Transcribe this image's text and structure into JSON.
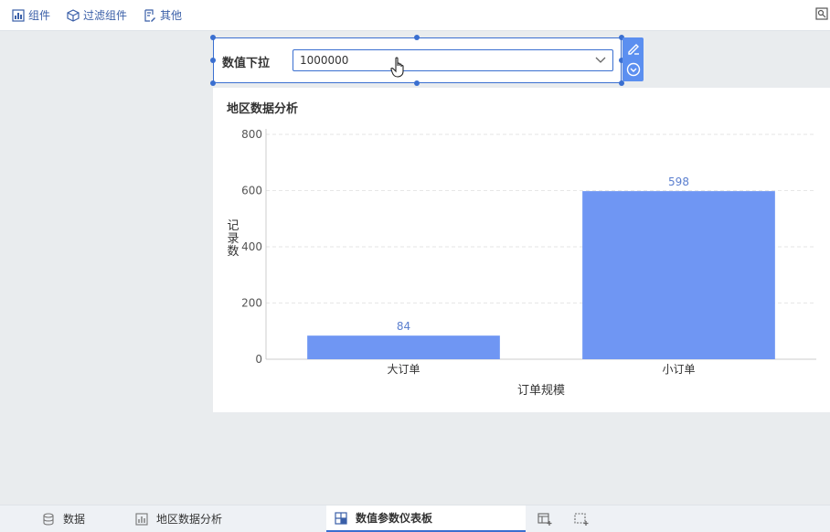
{
  "toolbar": {
    "items": [
      {
        "label": "组件",
        "icon": "chart-component-icon"
      },
      {
        "label": "过滤组件",
        "icon": "cube-filter-icon"
      },
      {
        "label": "其他",
        "icon": "edit-doc-icon"
      }
    ],
    "right_icon": "preview-icon"
  },
  "filter_widget": {
    "label": "数值下拉",
    "value": "1000000",
    "dropdown_icon": "chevron-down-icon",
    "side_tools": [
      "edit-icon",
      "collapse-icon"
    ]
  },
  "chart_widget": {
    "title": "地区数据分析"
  },
  "chart_data": {
    "type": "bar",
    "categories": [
      "大订单",
      "小订单"
    ],
    "values": [
      84,
      598
    ],
    "xlabel": "订单规模",
    "ylabel": "记录数",
    "ylim": [
      0,
      800
    ],
    "yticks": [
      "0",
      "200",
      "400",
      "600",
      "800"
    ],
    "data_labels": [
      "84",
      "598"
    ],
    "bar_color": "#6f96f3",
    "label_color": "#5b7fcf",
    "grid": true
  },
  "tabs": {
    "items": [
      {
        "label": "数据",
        "icon": "database-icon",
        "active": false
      },
      {
        "label": "地区数据分析",
        "icon": "bar-chart-icon",
        "active": false
      },
      {
        "label": "数值参数仪表板",
        "icon": "dashboard-icon",
        "active": true
      }
    ],
    "buttons": [
      "add-dashboard-icon",
      "add-story-icon"
    ]
  }
}
